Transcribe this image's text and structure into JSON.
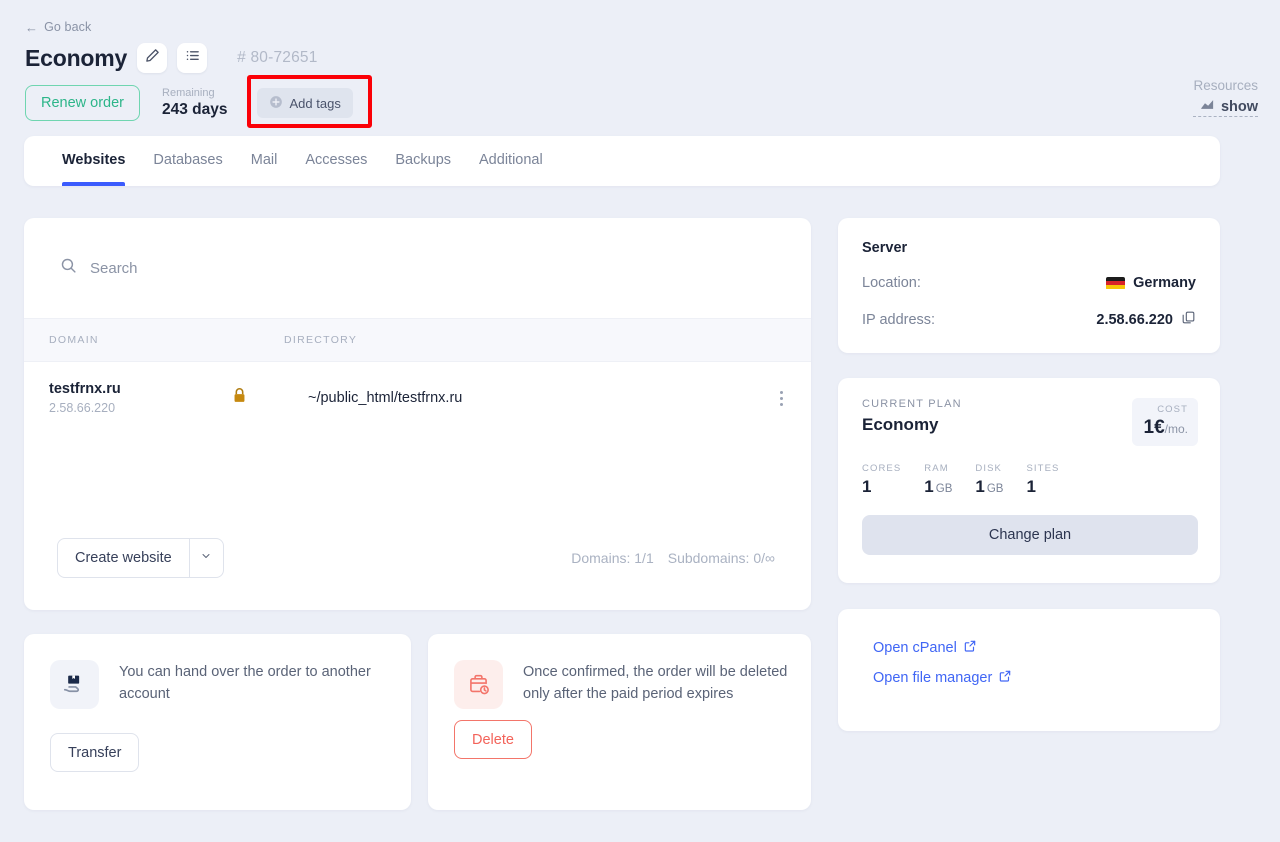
{
  "header": {
    "go_back": "Go back",
    "title": "Economy",
    "order_number": "# 80-72651",
    "edit_icon": "pencil-icon",
    "list_icon": "list-icon",
    "renew_label": "Renew order",
    "remaining_label": "Remaining",
    "remaining_value": "243 days",
    "add_tags_label": "Add tags",
    "resources_label": "Resources",
    "resources_link": "show",
    "highlight_color": "#fb0007"
  },
  "tabs": [
    {
      "label": "Websites",
      "active": true
    },
    {
      "label": "Databases",
      "active": false
    },
    {
      "label": "Mail",
      "active": false
    },
    {
      "label": "Accesses",
      "active": false
    },
    {
      "label": "Backups",
      "active": false
    },
    {
      "label": "Additional",
      "active": false
    }
  ],
  "websites": {
    "search_placeholder": "Search",
    "columns": {
      "domain": "DOMAIN",
      "directory": "DIRECTORY"
    },
    "rows": [
      {
        "domain": "testfrnx.ru",
        "ip": "2.58.66.220",
        "secure": true,
        "directory": "~/public_html/testfrnx.ru"
      }
    ],
    "create_button": "Create website",
    "domains_count": "Domains: 1/1",
    "subdomains_count": "Subdomains: 0/∞"
  },
  "server": {
    "title": "Server",
    "location_label": "Location:",
    "location_value": "Germany",
    "ip_label": "IP address:",
    "ip_value": "2.58.66.220"
  },
  "plan": {
    "current_plan_label": "CURRENT PLAN",
    "plan_name": "Economy",
    "cost_label": "COST",
    "cost_value": "1€",
    "cost_period": "/mo.",
    "specs": [
      {
        "label": "CORES",
        "value": "1",
        "unit": ""
      },
      {
        "label": "RAM",
        "value": "1",
        "unit": "GB"
      },
      {
        "label": "DISK",
        "value": "1",
        "unit": "GB"
      },
      {
        "label": "SITES",
        "value": "1",
        "unit": ""
      }
    ],
    "change_plan_label": "Change plan"
  },
  "links": [
    {
      "label": "Open cPanel"
    },
    {
      "label": "Open file manager"
    }
  ],
  "transfer": {
    "text": "You can hand over the order to another account",
    "button": "Transfer"
  },
  "delete": {
    "text": "Once confirmed, the order will be deleted only after the paid period expires",
    "button": "Delete"
  }
}
